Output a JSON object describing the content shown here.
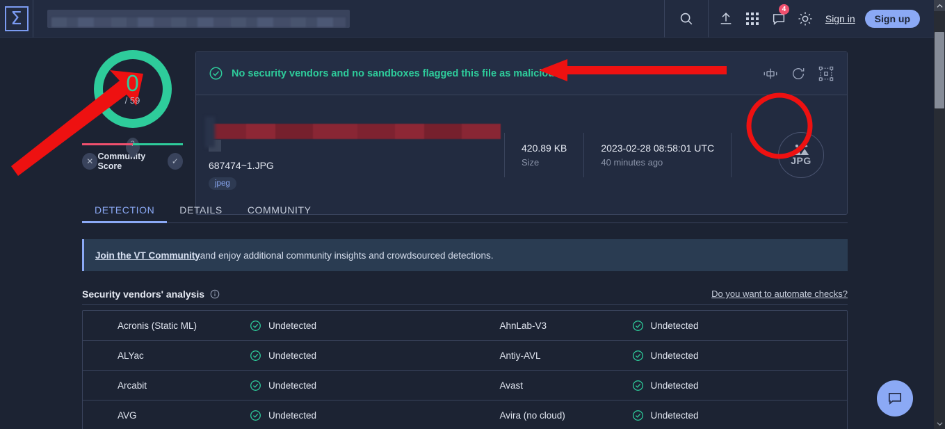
{
  "header": {
    "logo": "Σ",
    "search_placeholder": "",
    "search_value_redacted": true,
    "icons": [
      {
        "name": "search-icon",
        "label": "Search"
      },
      {
        "name": "upload-icon",
        "label": "Upload"
      },
      {
        "name": "apps-grid-icon",
        "label": "Apps"
      },
      {
        "name": "chat-icon",
        "label": "Notifications",
        "badge": "4"
      },
      {
        "name": "theme-sun-icon",
        "label": "Theme"
      }
    ],
    "sign_in": "Sign in",
    "sign_up": "Sign up"
  },
  "summary": {
    "gauge": {
      "detections": "0",
      "total": "/ 59",
      "ring_color": "#2ecc9b"
    },
    "community_score": {
      "label": "Community Score",
      "tooltip_marker": "?",
      "negative_button": "✕",
      "positive_button": "✓"
    },
    "verdict": {
      "icon": "check-circle-icon",
      "text": "No security vendors and no sandboxes flagged this file as malicious",
      "color": "#2ecc9b"
    },
    "card_actions": [
      {
        "name": "similar-files-icon",
        "label": "Similar"
      },
      {
        "name": "reanalyze-icon",
        "label": "Reanalyze"
      },
      {
        "name": "vt-graph-icon",
        "label": "Graph"
      }
    ],
    "file": {
      "hash_redacted": true,
      "name": "687474~1.JPG",
      "tag": "jpeg",
      "size_value": "420.89 KB",
      "size_label": "Size",
      "date_value": "2023-02-28 08:58:01 UTC",
      "date_label": "40 minutes ago",
      "type_icon": "image-file-icon",
      "type_label": "JPG"
    }
  },
  "tabs": [
    {
      "label": "DETECTION",
      "active": true
    },
    {
      "label": "DETAILS",
      "active": false
    },
    {
      "label": "COMMUNITY",
      "active": false
    }
  ],
  "community_banner": {
    "link": "Join the VT Community",
    "text": " and enjoy additional community insights and crowdsourced detections."
  },
  "vendors_section": {
    "title": "Security vendors' analysis",
    "info_icon": "info-icon",
    "automate_link": "Do you want to automate checks?",
    "rows": [
      {
        "left_name": "Acronis (Static ML)",
        "left_status": "Undetected",
        "right_name": "AhnLab-V3",
        "right_status": "Undetected"
      },
      {
        "left_name": "ALYac",
        "left_status": "Undetected",
        "right_name": "Antiy-AVL",
        "right_status": "Undetected"
      },
      {
        "left_name": "Arcabit",
        "left_status": "Undetected",
        "right_name": "Avast",
        "right_status": "Undetected"
      },
      {
        "left_name": "AVG",
        "left_status": "Undetected",
        "right_name": "Avira (no cloud)",
        "right_status": "Undetected"
      }
    ]
  },
  "floating_chat": {
    "icon": "chat-bubble-icon"
  },
  "scrollbar": {
    "up": "⌃",
    "down": "⌄"
  },
  "annotations": {
    "arrow_color": "#ee1111",
    "arrow_to_gauge": "points at detection score gauge",
    "arrow_to_verdict": "points at no-vendors-flagged banner",
    "circle_on_filetype": "highlights the JPG file type icon"
  }
}
